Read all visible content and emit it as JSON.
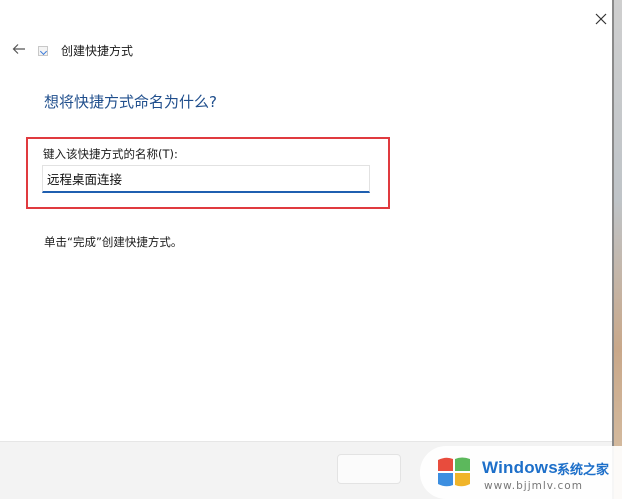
{
  "window": {
    "close_icon": "close-icon",
    "back_icon": "back-arrow-icon"
  },
  "wizard": {
    "icon": "shortcut-wizard-icon",
    "title": "创建快捷方式",
    "heading": "想将快捷方式命名为什么?",
    "field_label": "键入该快捷方式的名称(T):",
    "field_value": "远程桌面连接",
    "hint": "单击“完成”创建快捷方式。"
  },
  "colors": {
    "heading": "#1f4e8c",
    "highlight_box": "#e03a3f",
    "input_focus": "#1f5fb0",
    "watermark_brand": "#1d6fc9"
  },
  "watermark": {
    "brand": "Windows",
    "site": "系统之家",
    "url": "www.bjjmlv.com"
  }
}
